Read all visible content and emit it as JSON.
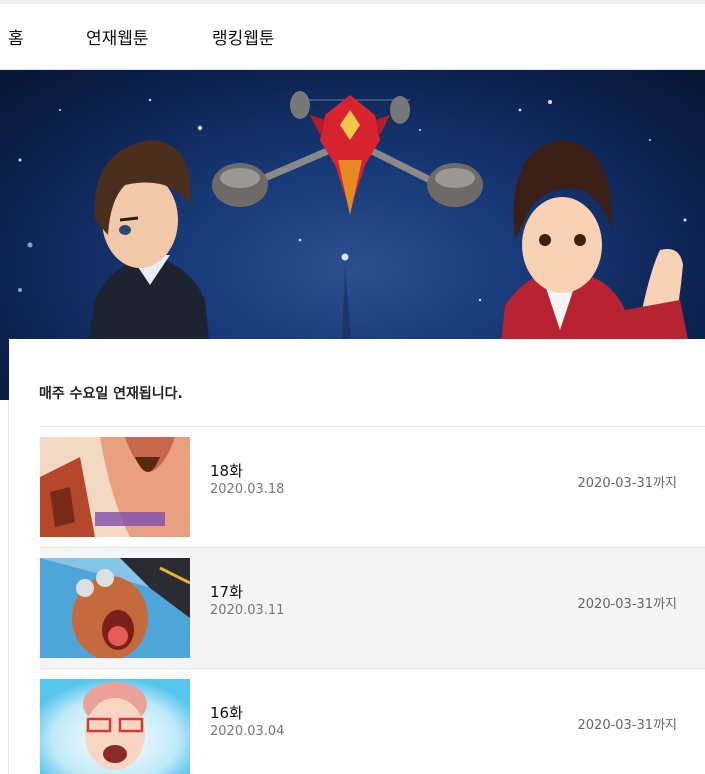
{
  "nav": {
    "home": "홈",
    "serial": "연재웹툰",
    "ranking": "랭킹웹툰"
  },
  "banner": {
    "icon": "webtoon-banner-art"
  },
  "notice": "매주 수요일 연재됩니다.",
  "episodes": [
    {
      "title": "18화",
      "date": "2020.03.18",
      "until": "2020-03-31까지"
    },
    {
      "title": "17화",
      "date": "2020.03.11",
      "until": "2020-03-31까지"
    },
    {
      "title": "16화",
      "date": "2020.03.04",
      "until": "2020-03-31까지"
    }
  ],
  "colors": {
    "banner_sky": "#0d2352",
    "row_alt": "#f5f5f5",
    "divider": "#e3e3e3"
  }
}
